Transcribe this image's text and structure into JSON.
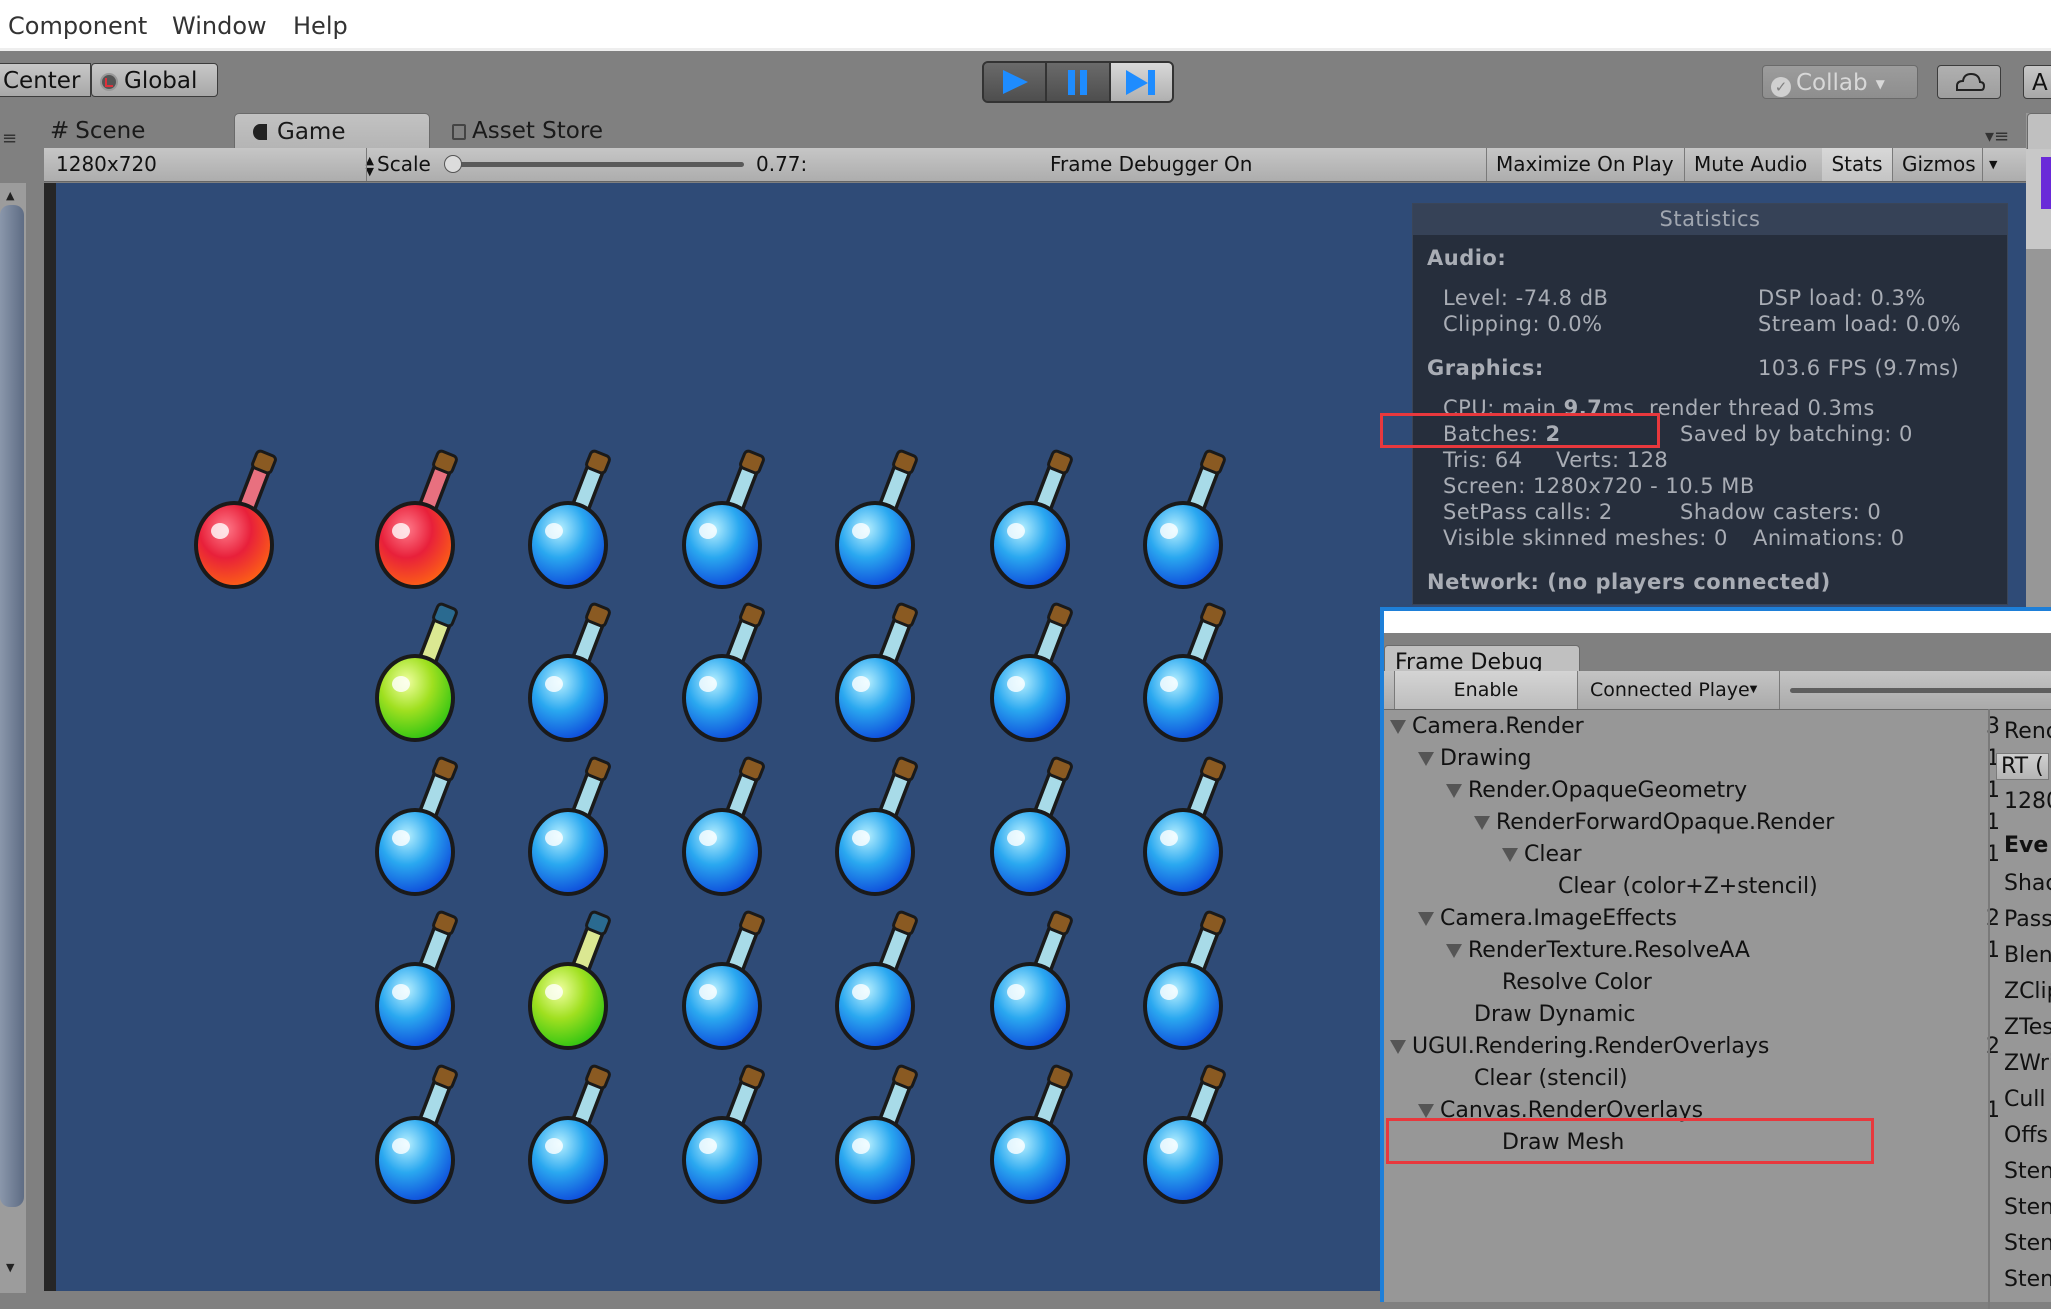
{
  "menu": {
    "items": [
      "Component",
      "Window",
      "Help"
    ]
  },
  "toolbar": {
    "pivot_mode": "Center",
    "pivot_rotation": "Global",
    "play_icon": "play-icon",
    "pause_icon": "pause-icon",
    "step_icon": "step-icon",
    "collab_label": "Collab",
    "cloud_icon": "cloud-icon",
    "account_label": "A"
  },
  "dock_tabs": [
    {
      "label": "Scene",
      "icon": "hash-icon"
    },
    {
      "label": "Game",
      "icon": "pacman-icon",
      "active": true
    },
    {
      "label": "Asset Store",
      "icon": "bag-icon"
    }
  ],
  "game_toolbar": {
    "resolution": "1280x720",
    "scale_label": "Scale",
    "scale_value": "0.77:",
    "scale_slider_fraction": 0.0,
    "status": "Frame Debugger On",
    "buttons": [
      "Maximize On Play",
      "Mute Audio",
      "Stats",
      "Gizmos"
    ]
  },
  "game_view": {
    "background": "#2f4b77",
    "grid_columns": 7,
    "grid_rows": 5,
    "bottles": [
      [
        "red",
        null,
        "red",
        "blue",
        "blue",
        "blue",
        "blue",
        "blue"
      ],
      [
        null,
        "green",
        "blue",
        "blue",
        "blue",
        "blue",
        "blue"
      ],
      [
        null,
        "blue",
        "blue",
        "blue",
        "blue",
        "blue",
        "blue"
      ],
      [
        null,
        "blue",
        "green",
        "blue",
        "blue",
        "blue",
        "blue"
      ],
      [
        null,
        "blue",
        "blue",
        "blue",
        "blue",
        "blue",
        "blue"
      ]
    ],
    "bottle_colors": {
      "red": [
        "#ff7a8a",
        "#e8203a",
        "#ff6a10"
      ],
      "blue": [
        "#b8f0ff",
        "#2aa8f0",
        "#0a3fd8"
      ],
      "green": [
        "#f0ffa0",
        "#a0e020",
        "#20c010"
      ]
    }
  },
  "statistics": {
    "title": "Statistics",
    "audio_header": "Audio:",
    "level": "Level: -74.8 dB",
    "dsp_load": "DSP load: 0.3%",
    "clipping": "Clipping: 0.0%",
    "stream_load": "Stream load: 0.0%",
    "graphics_header": "Graphics:",
    "fps": "103.6 FPS (9.7ms)",
    "cpu_prefix": "CPU: main ",
    "cpu_main": "9.7",
    "cpu_suffix": "ms  render thread 0.3ms",
    "batches_label": "Batches: ",
    "batches_value": "2",
    "saved_by_batching": "Saved by batching: 0",
    "tris": "Tris: 64",
    "verts": "Verts: 128",
    "screen": "Screen: 1280x720 - 10.5 MB",
    "setpass": "SetPass calls: 2",
    "shadow_casters": "Shadow casters: 0",
    "skinned": "Visible skinned meshes: 0",
    "animations": "Animations: 0",
    "network": "Network: (no players connected)"
  },
  "frame_debug": {
    "tab_label": "Frame Debug",
    "enable_label": "Enable",
    "target_label": "Connected Playe",
    "tree": [
      {
        "label": "Camera.Render",
        "count": "3",
        "depth": 0,
        "expanded": true
      },
      {
        "label": "Drawing",
        "count": "1",
        "depth": 1,
        "expanded": true
      },
      {
        "label": "Render.OpaqueGeometry",
        "count": "1",
        "depth": 2,
        "expanded": true
      },
      {
        "label": "RenderForwardOpaque.Render",
        "count": "1",
        "depth": 3,
        "expanded": true
      },
      {
        "label": "Clear",
        "count": "1",
        "depth": 4,
        "expanded": true
      },
      {
        "label": "Clear (color+Z+stencil)",
        "count": "",
        "depth": 5,
        "expanded": null
      },
      {
        "label": "Camera.ImageEffects",
        "count": "2",
        "depth": 1,
        "expanded": true
      },
      {
        "label": "RenderTexture.ResolveAA",
        "count": "1",
        "depth": 2,
        "expanded": true
      },
      {
        "label": "Resolve Color",
        "count": "",
        "depth": 3,
        "expanded": null
      },
      {
        "label": "Draw Dynamic",
        "count": "",
        "depth": 2,
        "expanded": null
      },
      {
        "label": "UGUI.Rendering.RenderOverlays",
        "count": "2",
        "depth": 0,
        "expanded": true
      },
      {
        "label": "Clear (stencil)",
        "count": "",
        "depth": 2,
        "expanded": null
      },
      {
        "label": "Canvas.RenderOverlays",
        "count": "1",
        "depth": 1,
        "expanded": true
      },
      {
        "label": "Draw Mesh",
        "count": "",
        "depth": 3,
        "expanded": null,
        "highlighted": true
      }
    ],
    "detail_lines": [
      "Renc",
      "RT (",
      "1280",
      "Eve",
      "Shac",
      "Pass",
      "Blen",
      "ZClip",
      "ZTes",
      "ZWri",
      "Cull",
      "Offs",
      "Sten",
      "Sten",
      "Sten",
      "Sten"
    ]
  },
  "highlight_color": "#e8383d"
}
